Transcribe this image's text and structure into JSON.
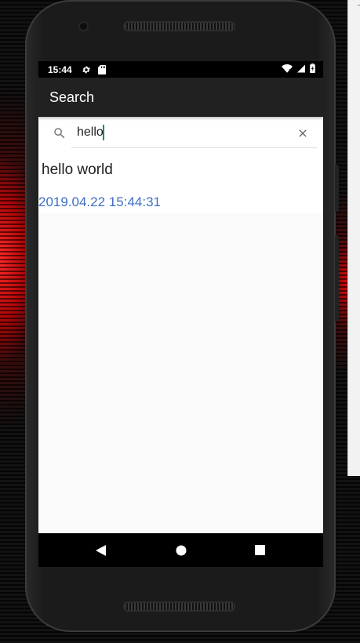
{
  "status_bar": {
    "time": "15:44",
    "icons": [
      "gear-icon",
      "sd-card-icon",
      "wifi-icon",
      "signal-icon",
      "battery-icon"
    ]
  },
  "app_bar": {
    "title": "Search"
  },
  "search": {
    "value": "hello",
    "icon": "search-icon",
    "clear_icon": "close-icon"
  },
  "results": [
    {
      "title": "hello world",
      "date": "2019.04.22 15:44:31"
    }
  ],
  "nav_bar": {
    "icons": [
      "back-icon",
      "home-icon",
      "recents-icon"
    ]
  },
  "colors": {
    "app_bar": "#212121",
    "date_text": "#3f6fc4",
    "cursor": "#00897b"
  }
}
